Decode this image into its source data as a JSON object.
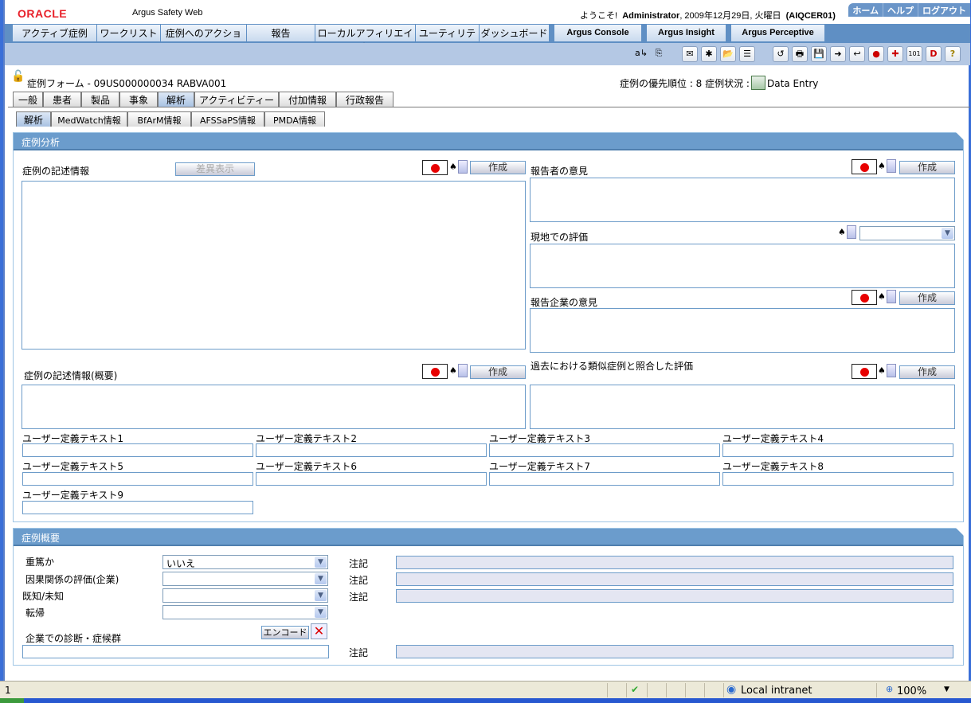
{
  "header": {
    "brand": "ORACLE",
    "app_name": "Argus Safety Web",
    "welcome_prefix": "ようこそ!",
    "user": "Administrator",
    "date": ", 2009年12月29日, 火曜日",
    "server": "(AIQCER01)",
    "links": [
      "ホーム",
      "ヘルプ",
      "ログアウト"
    ]
  },
  "nav": {
    "items": [
      "アクティブ症例",
      "ワークリスト",
      "症例へのアクション",
      "報告",
      "ローカルアフィリエイト",
      "ユーティリティ",
      "ダッシュボード"
    ],
    "bold_items": [
      "Argus Console",
      "Argus Insight",
      "Argus Perceptive"
    ]
  },
  "toolbar": {
    "icons": [
      "translate-icon",
      "copy-icon",
      "scan-icon",
      "new-case-icon",
      "open-folder-icon",
      "list-icon",
      "open-case-icon",
      "print-icon",
      "save-icon",
      "forward-icon",
      "return-icon",
      "lock-icon",
      "medical-review-icon",
      "coding-review-icon",
      "draft-icon",
      "help-icon"
    ],
    "glyphs": [
      "a↳",
      "⎘",
      "✉",
      "✱",
      "📂",
      "☰",
      "↺",
      "🖶",
      "💾",
      "➜",
      "↩",
      "●",
      "✚",
      "101",
      "D",
      "?"
    ]
  },
  "case": {
    "title": "症例フォーム - 09US000000034 RABVA001",
    "priority_label": "症例の優先順位 : 8 症例状況 :",
    "status": "Data Entry"
  },
  "tabs": {
    "main": [
      "一般",
      "患者",
      "製品",
      "事象",
      "解析",
      "アクティビティー",
      "付加情報",
      "行政報告"
    ],
    "main_active": "解析",
    "sub": [
      "解析",
      "MedWatch情報",
      "BfArM情報",
      "AFSSaPS情報",
      "PMDA情報"
    ],
    "sub_active": "解析"
  },
  "analysis": {
    "title": "症例分析",
    "narrative_label": "症例の記述情報",
    "diff_button": "差異表示",
    "create_button": "作成",
    "reporter_comment_label": "報告者の意見",
    "local_eval_label": "現地での評価",
    "company_comment_label": "報告企業の意見",
    "narrative_summary_label": "症例の記述情報(概要)",
    "past_eval_label": "過去における類似症例と照合した評価",
    "user_text_labels": [
      "ユーザー定義テキスト1",
      "ユーザー定義テキスト2",
      "ユーザー定義テキスト3",
      "ユーザー定義テキスト4",
      "ユーザー定義テキスト5",
      "ユーザー定義テキスト6",
      "ユーザー定義テキスト7",
      "ユーザー定義テキスト8",
      "ユーザー定義テキスト9"
    ]
  },
  "summary": {
    "title": "症例概要",
    "rows": [
      {
        "label": "重篤か",
        "value": "いいえ",
        "note": "注記"
      },
      {
        "label": "因果関係の評価(企業)",
        "value": "",
        "note": "注記"
      },
      {
        "label": "既知/未知",
        "value": "",
        "note": "注記"
      },
      {
        "label": "転帰",
        "value": ""
      }
    ],
    "diagnosis_label": "企業での診断・症候群",
    "encode_button": "エンコード",
    "diagnosis_note": "注記"
  },
  "statusbar": {
    "left": "1",
    "zone": "Local intranet",
    "zoom": "100%"
  }
}
